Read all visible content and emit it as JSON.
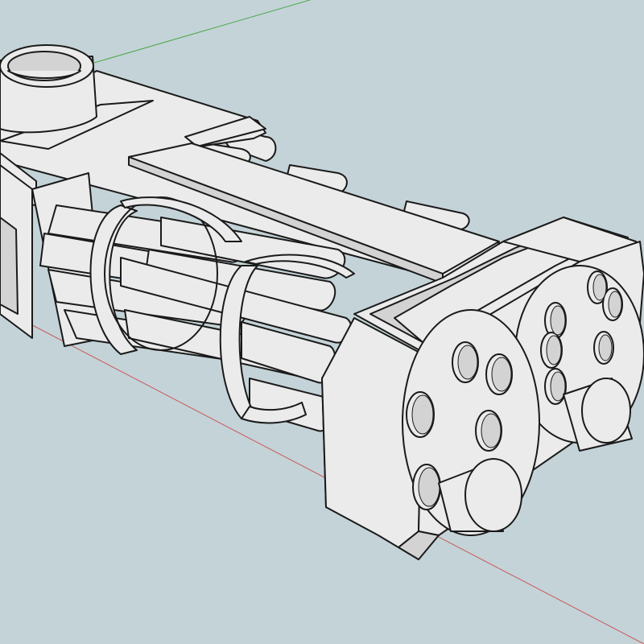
{
  "viewport": {
    "background": "#c4d3d8",
    "model_fill": "#ebebeb",
    "model_shade": "#d3d3d3",
    "edge_color": "#1a1a1a",
    "green_axis_color": "#4aa84a",
    "red_axis_color": "#c85a5a"
  },
  "model": {
    "front_panels": [
      {
        "barrel_holes": 6,
        "center_hub": "cylinder"
      },
      {
        "barrel_holes": 6,
        "center_hub": "cylinder"
      }
    ],
    "barrel_clusters": 2,
    "barrel_rings": 2,
    "top_fitting": "cylinder"
  }
}
